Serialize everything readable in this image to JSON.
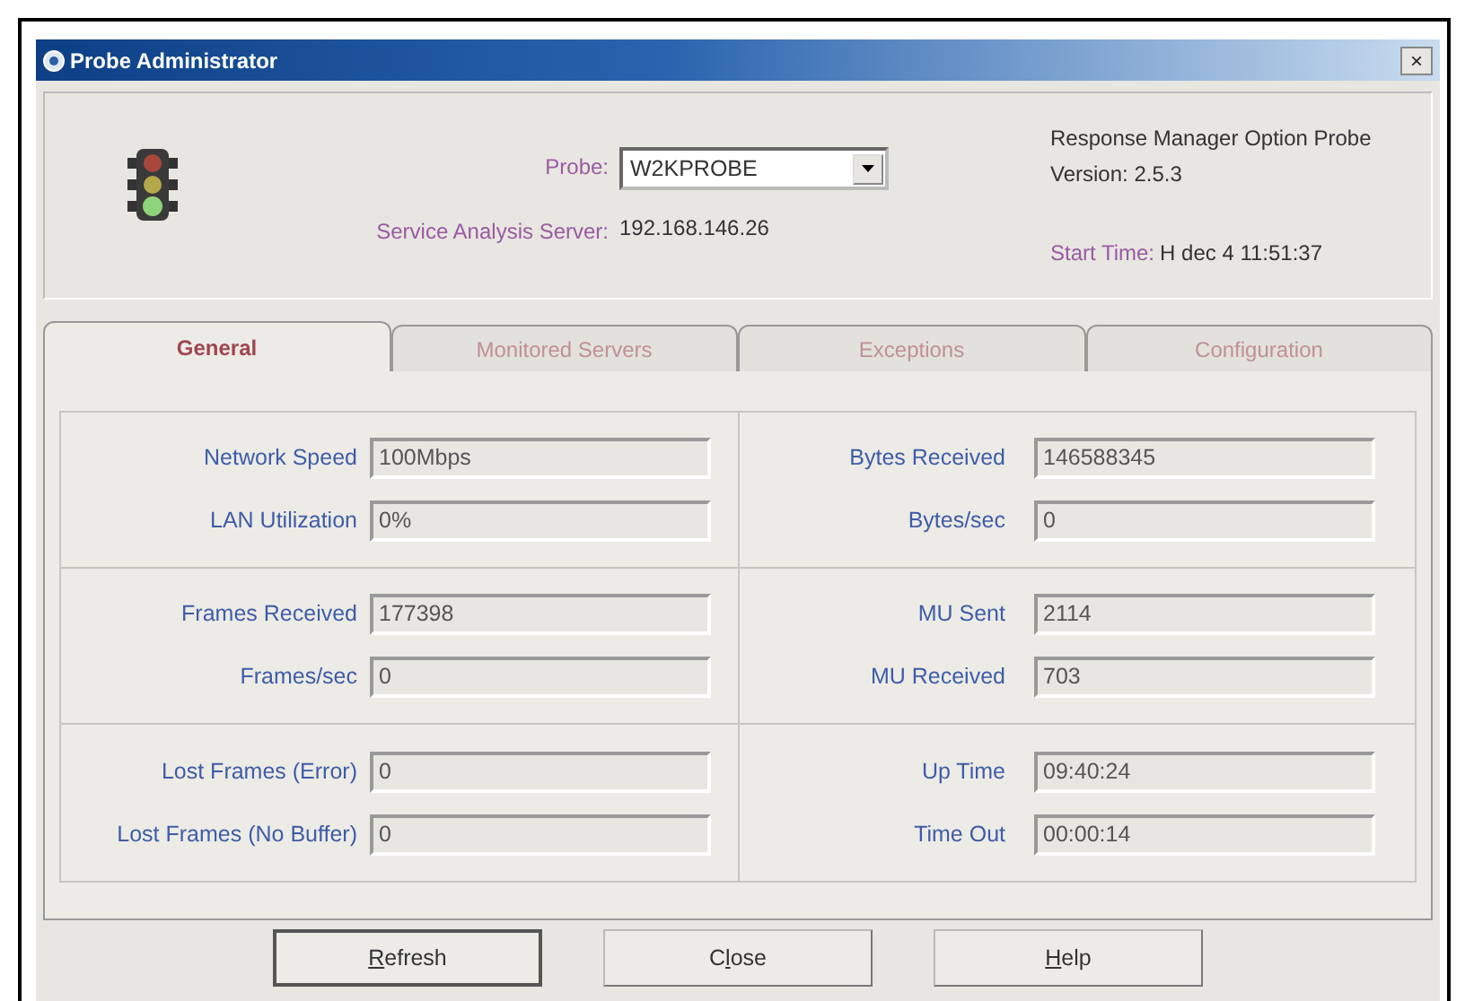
{
  "window": {
    "title": "Probe Administrator",
    "close_glyph": "×"
  },
  "header": {
    "probe_label": "Probe:",
    "probe_value": "W2KPROBE",
    "server_label": "Service Analysis Server:",
    "server_value": "192.168.146.26",
    "product": "Response Manager Option Probe",
    "version": "Version: 2.5.3",
    "start_label": "Start Time:",
    "start_value": "H dec 4 11:51:37"
  },
  "tabs": [
    {
      "label": "General",
      "selected": true
    },
    {
      "label": "Monitored Servers",
      "selected": false
    },
    {
      "label": "Exceptions",
      "selected": false
    },
    {
      "label": "Configuration",
      "selected": false
    }
  ],
  "sections": [
    {
      "left": [
        {
          "label": "Network Speed",
          "value": "100Mbps"
        },
        {
          "label": "LAN Utilization",
          "value": "0%"
        }
      ],
      "right": [
        {
          "label": "Bytes Received",
          "value": "146588345"
        },
        {
          "label": "Bytes/sec",
          "value": "0"
        }
      ]
    },
    {
      "left": [
        {
          "label": "Frames Received",
          "value": "177398"
        },
        {
          "label": "Frames/sec",
          "value": "0"
        }
      ],
      "right": [
        {
          "label": "MU Sent",
          "value": "2114"
        },
        {
          "label": "MU Received",
          "value": "703"
        }
      ]
    },
    {
      "left": [
        {
          "label": "Lost Frames (Error)",
          "value": "0"
        },
        {
          "label": "Lost Frames (No Buffer)",
          "value": "0"
        }
      ],
      "right": [
        {
          "label": "Up Time",
          "value": "09:40:24"
        },
        {
          "label": "Time Out",
          "value": "00:00:14"
        }
      ]
    }
  ],
  "buttons": [
    {
      "access_key": "R",
      "after_key": "efresh",
      "default": true
    },
    {
      "before_key": "C",
      "access_key": "l",
      "after_key": "ose",
      "default": false
    },
    {
      "access_key": "H",
      "after_key": "elp",
      "default": false
    }
  ]
}
